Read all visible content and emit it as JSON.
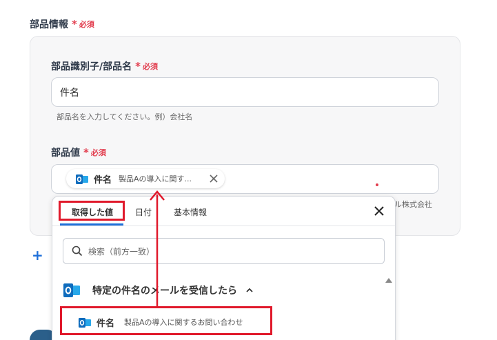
{
  "section": {
    "label": "部品情報",
    "required_mark": "*",
    "required_text": "必須"
  },
  "field1": {
    "label": "部品識別子/部品名",
    "required_mark": "*",
    "required_text": "必須",
    "value": "件名",
    "hint": "部品名を入力してください。例）会社名"
  },
  "field2": {
    "label": "部品値",
    "required_mark": "*",
    "required_text": "必須",
    "chip": {
      "icon": "outlook-icon",
      "name": "件名",
      "value": "製品Aの導入に関す..."
    },
    "hint_tail": "ル株式会社"
  },
  "add": {
    "label": "+"
  },
  "dropdown": {
    "tabs": [
      {
        "label": "取得した値",
        "active": true
      },
      {
        "label": "日付",
        "active": false
      },
      {
        "label": "基本情報",
        "active": false
      }
    ],
    "search_placeholder": "検索（前方一致）",
    "group": {
      "icon": "outlook-icon",
      "label": "特定の件名のメールを受信したら",
      "expanded": true
    },
    "item": {
      "icon": "outlook-icon",
      "name": "件名",
      "value": "製品Aの導入に関するお問い合わせ"
    }
  },
  "colors": {
    "required": "#e23c4d",
    "accent": "#1e6fd9",
    "annotation": "#e0192b",
    "outlook": "#0f6cbd"
  }
}
